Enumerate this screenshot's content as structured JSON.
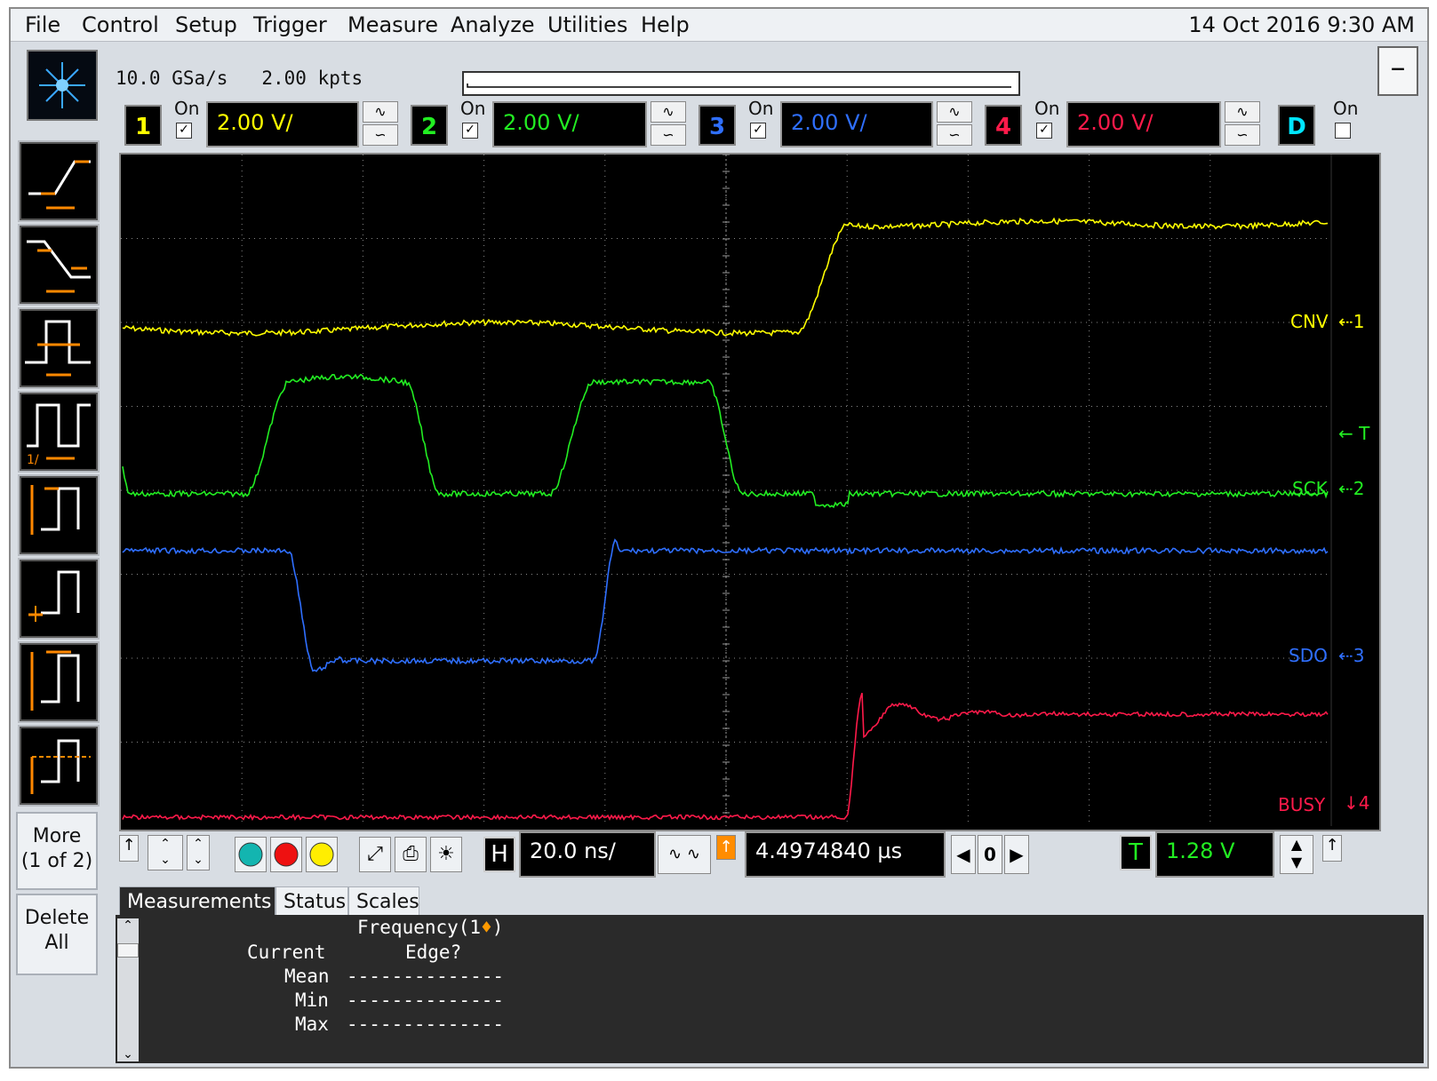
{
  "menu": [
    "File",
    "Control",
    "Setup",
    "Trigger",
    "Measure",
    "Analyze",
    "Utilities",
    "Help"
  ],
  "clock": "14 Oct 2016  9:30 AM",
  "acquisition": {
    "sample_rate": "10.0 GSa/s",
    "points": "2.00 kpts"
  },
  "channels": [
    {
      "num": "1",
      "on_label": "On",
      "scale": "2.00 V/",
      "color": "#ffff00"
    },
    {
      "num": "2",
      "on_label": "On",
      "scale": "2.00 V/",
      "color": "#22ee22"
    },
    {
      "num": "3",
      "on_label": "On",
      "scale": "2.00 V/",
      "color": "#2f6fff"
    },
    {
      "num": "4",
      "on_label": "On",
      "scale": "2.00 V/",
      "color": "#ff1a4a"
    }
  ],
  "digital": {
    "label": "D",
    "on_label": "On"
  },
  "trace_labels": {
    "cnv": "CNV",
    "sck": "SCK",
    "sdo": "SDO",
    "busy": "BUSY",
    "trigger_marker": "T"
  },
  "sidebar": {
    "more": "More",
    "more_page": "(1 of 2)",
    "delete": "Delete",
    "delete_all": "All"
  },
  "horizontal": {
    "h_label": "H",
    "scale": "20.0 ns/",
    "delay": "4.4974840 µs",
    "nav_value": "0"
  },
  "trigger": {
    "t_label": "T",
    "level": "1.28 V"
  },
  "tabs": [
    "Measurements",
    "Status",
    "Scales"
  ],
  "measurements": {
    "title": "Frequency(1",
    "title_marker": "♦",
    "title_close": ")",
    "rows": [
      {
        "label": "Current",
        "value": "Edge?"
      },
      {
        "label": "Mean",
        "value": "--------------"
      },
      {
        "label": "Min",
        "value": "--------------"
      },
      {
        "label": "Max",
        "value": "--------------"
      }
    ]
  }
}
